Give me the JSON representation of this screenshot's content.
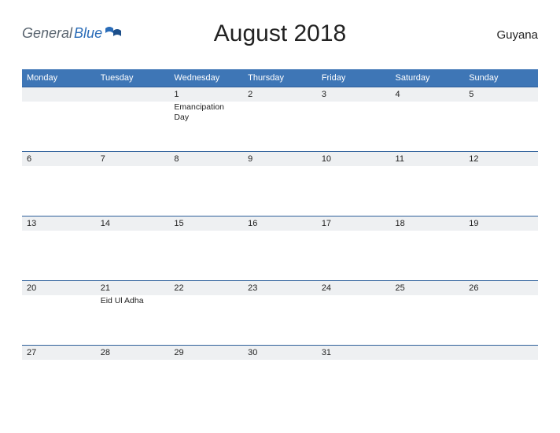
{
  "header": {
    "logo_part1": "General",
    "logo_part2": "Blue",
    "title": "August 2018",
    "region": "Guyana"
  },
  "days": [
    "Monday",
    "Tuesday",
    "Wednesday",
    "Thursday",
    "Friday",
    "Saturday",
    "Sunday"
  ],
  "weeks": [
    [
      {
        "date": "",
        "event": ""
      },
      {
        "date": "",
        "event": ""
      },
      {
        "date": "1",
        "event": "Emancipation Day"
      },
      {
        "date": "2",
        "event": ""
      },
      {
        "date": "3",
        "event": ""
      },
      {
        "date": "4",
        "event": ""
      },
      {
        "date": "5",
        "event": ""
      }
    ],
    [
      {
        "date": "6",
        "event": ""
      },
      {
        "date": "7",
        "event": ""
      },
      {
        "date": "8",
        "event": ""
      },
      {
        "date": "9",
        "event": ""
      },
      {
        "date": "10",
        "event": ""
      },
      {
        "date": "11",
        "event": ""
      },
      {
        "date": "12",
        "event": ""
      }
    ],
    [
      {
        "date": "13",
        "event": ""
      },
      {
        "date": "14",
        "event": ""
      },
      {
        "date": "15",
        "event": ""
      },
      {
        "date": "16",
        "event": ""
      },
      {
        "date": "17",
        "event": ""
      },
      {
        "date": "18",
        "event": ""
      },
      {
        "date": "19",
        "event": ""
      }
    ],
    [
      {
        "date": "20",
        "event": ""
      },
      {
        "date": "21",
        "event": "Eid Ul Adha"
      },
      {
        "date": "22",
        "event": ""
      },
      {
        "date": "23",
        "event": ""
      },
      {
        "date": "24",
        "event": ""
      },
      {
        "date": "25",
        "event": ""
      },
      {
        "date": "26",
        "event": ""
      }
    ],
    [
      {
        "date": "27",
        "event": ""
      },
      {
        "date": "28",
        "event": ""
      },
      {
        "date": "29",
        "event": ""
      },
      {
        "date": "30",
        "event": ""
      },
      {
        "date": "31",
        "event": ""
      },
      {
        "date": "",
        "event": ""
      },
      {
        "date": "",
        "event": ""
      }
    ]
  ]
}
